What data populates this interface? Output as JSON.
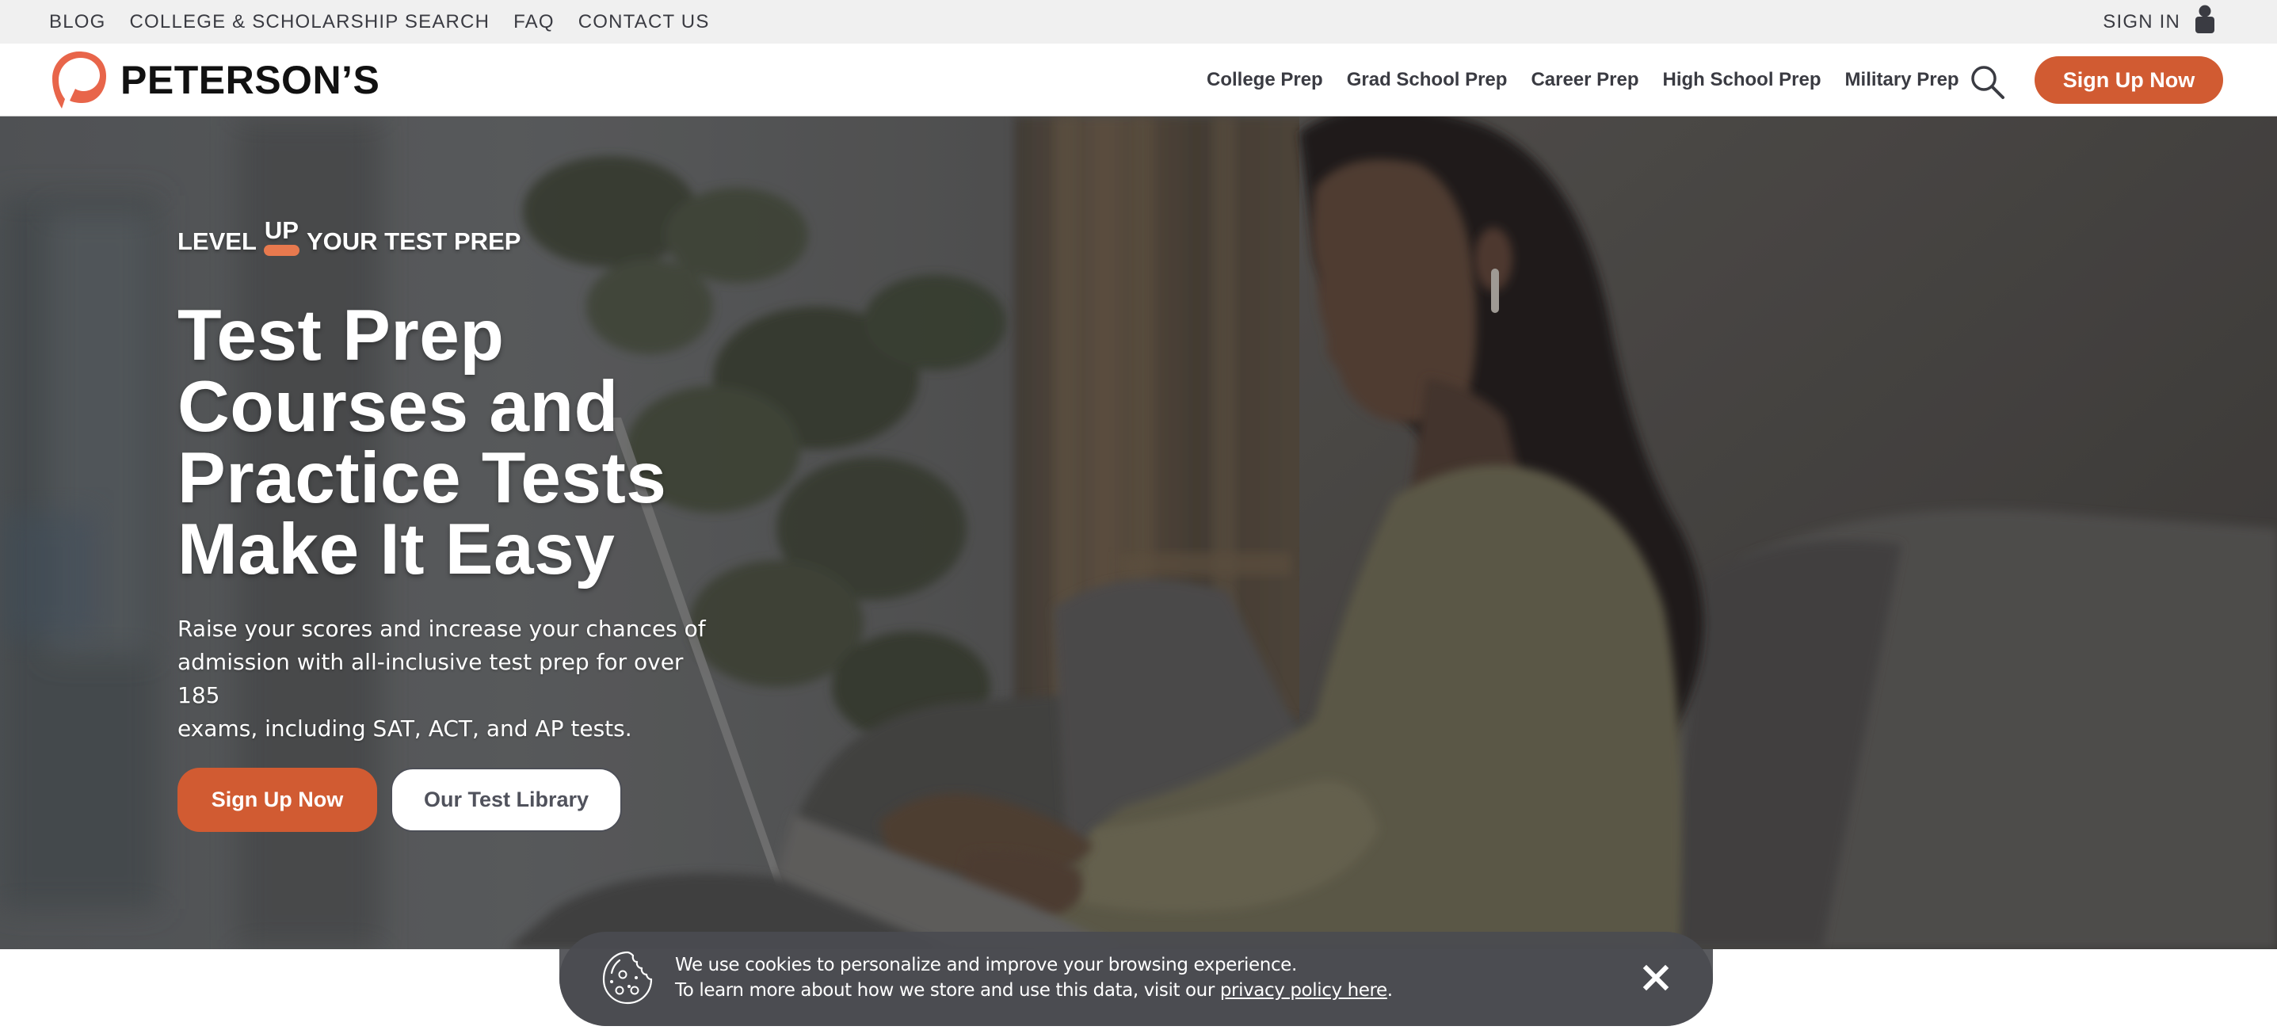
{
  "topbar": {
    "links": [
      "Blog",
      "College & Scholarship Search",
      "FAQ",
      "Contact Us"
    ],
    "sign_in": "Sign In",
    "sign_in_icon": "user-icon"
  },
  "navbar": {
    "brand": "PETERSON’S",
    "logo_icon": "petersons-p-logo",
    "items": [
      "College Prep",
      "Grad School Prep",
      "Career Prep",
      "High School Prep",
      "Military Prep"
    ],
    "search_icon": "search-icon",
    "cta": "Sign Up Now"
  },
  "hero": {
    "eyebrow_pre": "LEVEL",
    "eyebrow_up": "UP",
    "eyebrow_post": "YOUR TEST PREP",
    "headline_lines": [
      "Test Prep",
      "Courses and",
      "Practice Tests",
      "Make It Easy"
    ],
    "subcopy_lines": [
      "Raise your scores and increase your chances of",
      "admission with all-inclusive test prep for over 185",
      "exams, including SAT, ACT, and AP tests."
    ],
    "primary_button": "Sign Up Now",
    "secondary_button": "Our Test Library"
  },
  "cookie_banner": {
    "icon": "cookie-icon",
    "line1": "We use cookies to personalize and improve your browsing experience.",
    "line2_prefix": "To learn more about how we store and use this data, visit our ",
    "link_text": "privacy policy here",
    "line2_suffix": ".",
    "close_icon": "close-icon"
  },
  "colors": {
    "brand_orange": "#d15b32",
    "logo_orange": "#e8654a",
    "eyebrow_underline": "#e8794e",
    "topbar_bg": "#f0f0f0",
    "text_dark": "#3a3b42",
    "cookie_bg": "#5a5b5f"
  }
}
